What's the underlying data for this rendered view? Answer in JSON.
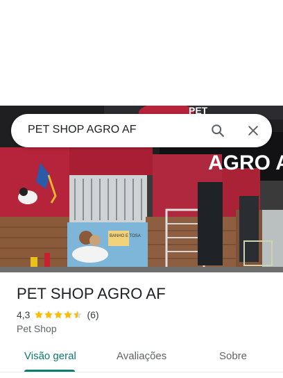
{
  "search": {
    "query": "PET SHOP AGRO AF"
  },
  "icons": {
    "search": "search-icon",
    "close": "close-icon",
    "star": "star-icon"
  },
  "photo": {
    "sign_text": "AGRO AF",
    "sign_top": "PET",
    "poster_text": "BANHO E TOSA"
  },
  "place": {
    "name": "PET SHOP AGRO AF",
    "rating": "4,3",
    "rating_value": 4.3,
    "review_count": "(6)",
    "category": "Pet Shop"
  },
  "tabs": [
    {
      "label": "Visão geral",
      "active": true
    },
    {
      "label": "Avaliações",
      "active": false
    },
    {
      "label": "Sobre",
      "active": false
    }
  ],
  "colors": {
    "accent": "#0b7a6f",
    "star": "#fbbc04",
    "storefront_red": "#b5243a"
  }
}
